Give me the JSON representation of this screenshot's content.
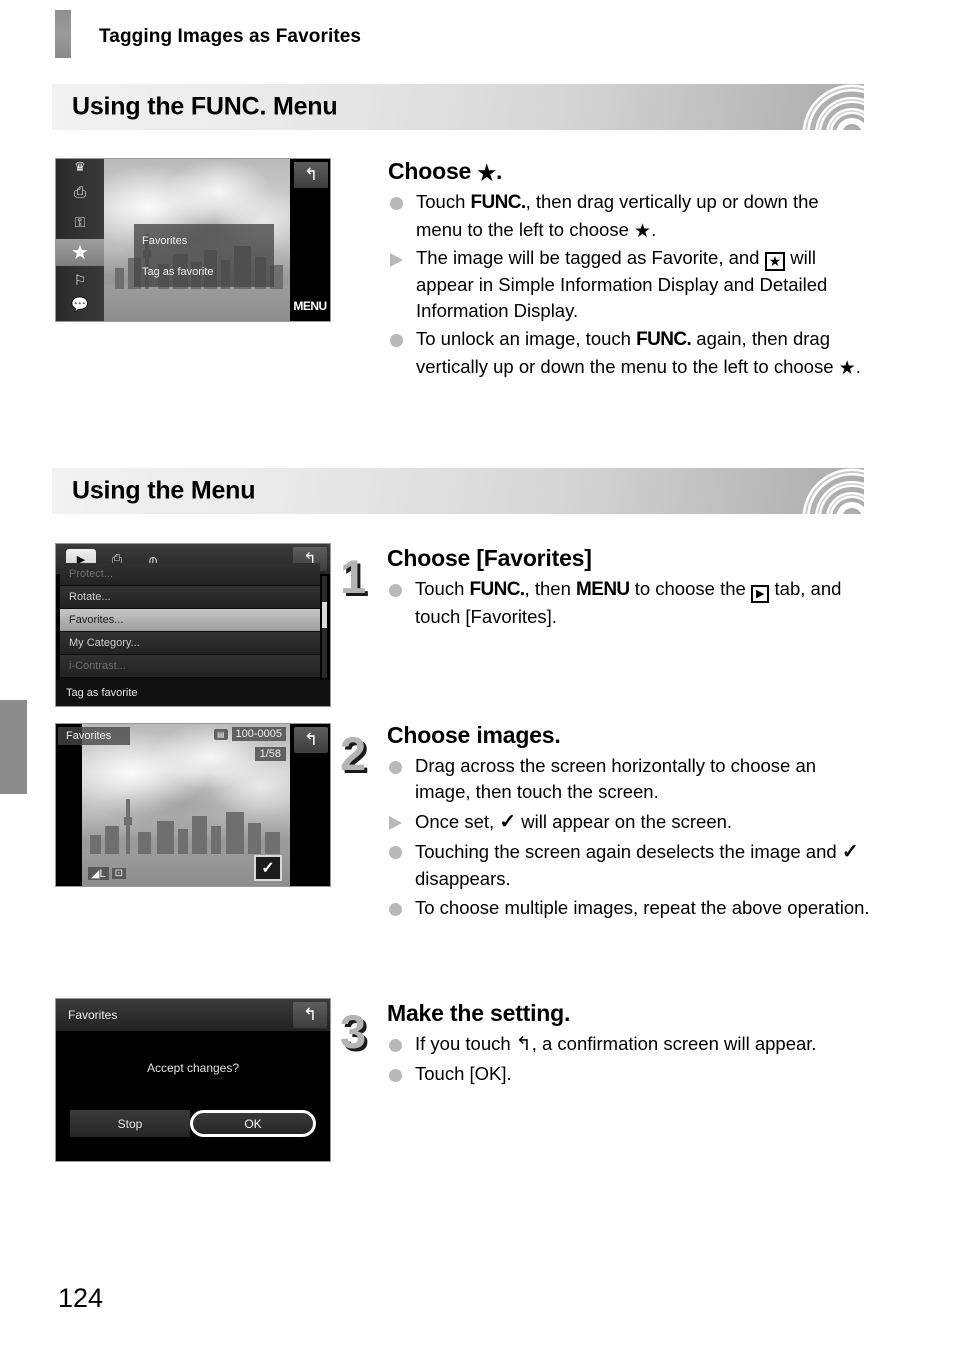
{
  "page": {
    "running_head": "Tagging Images as Favorites",
    "page_number": "124"
  },
  "sections": [
    {
      "title": "Using the FUNC. Menu"
    },
    {
      "title": "Using the Menu"
    }
  ],
  "func_section": {
    "heading": "Choose  ★.",
    "heading_prefix": "Choose",
    "heading_star": "★",
    "heading_suffix": ".",
    "bullets": [
      {
        "marker": "dot",
        "parts": [
          {
            "t": "Touch "
          },
          {
            "t": "FUNC.",
            "s": "func"
          },
          {
            "t": ", then drag vertically up or down the menu to the left to choose "
          },
          {
            "t": "★",
            "s": "star"
          },
          {
            "t": "."
          }
        ]
      },
      {
        "marker": "tri",
        "parts": [
          {
            "t": "The image will be tagged as Favorite, and "
          },
          {
            "t": "★",
            "s": "starbox"
          },
          {
            "t": " will appear in Simple Information Display and Detailed Information Display."
          }
        ]
      },
      {
        "marker": "dot",
        "parts": [
          {
            "t": "To unlock an image, touch "
          },
          {
            "t": "FUNC.",
            "s": "func"
          },
          {
            "t": " again, then drag vertically up or down the menu to the left to choose "
          },
          {
            "t": "★",
            "s": "star"
          },
          {
            "t": "."
          }
        ]
      }
    ]
  },
  "menu_section": {
    "steps": [
      {
        "number": "1",
        "heading": "Choose [Favorites]",
        "bullets": [
          {
            "marker": "dot",
            "parts": [
              {
                "t": "Touch "
              },
              {
                "t": "FUNC.",
                "s": "func"
              },
              {
                "t": ", then "
              },
              {
                "t": "MENU",
                "s": "menu"
              },
              {
                "t": " to choose the "
              },
              {
                "t": "▶",
                "s": "tabbox"
              },
              {
                "t": " tab, and touch [Favorites]."
              }
            ]
          }
        ]
      },
      {
        "number": "2",
        "heading": "Choose images.",
        "bullets": [
          {
            "marker": "dot",
            "parts": [
              {
                "t": "Drag across the screen horizontally to choose an image, then touch the screen."
              }
            ]
          },
          {
            "marker": "tri",
            "parts": [
              {
                "t": "Once set, "
              },
              {
                "t": "✓",
                "s": "check"
              },
              {
                "t": " will appear on the screen."
              }
            ]
          },
          {
            "marker": "dot",
            "parts": [
              {
                "t": "Touching the screen again deselects the image and "
              },
              {
                "t": "✓",
                "s": "check"
              },
              {
                "t": " disappears."
              }
            ]
          },
          {
            "marker": "dot",
            "parts": [
              {
                "t": "To choose multiple images, repeat the above operation."
              }
            ]
          }
        ]
      },
      {
        "number": "3",
        "heading": "Make the setting.",
        "bullets": [
          {
            "marker": "dot",
            "parts": [
              {
                "t": "If you touch "
              },
              {
                "t": "↰",
                "s": "back"
              },
              {
                "t": ", a confirmation screen will appear."
              }
            ]
          },
          {
            "marker": "dot",
            "parts": [
              {
                "t": "Touch [OK]."
              }
            ]
          }
        ]
      }
    ]
  },
  "screens": {
    "func_menu": {
      "caption_title": "Favorites",
      "caption_sub": "Tag as favorite",
      "menu_label": "MENU",
      "back_icon": "back-arrow-icon",
      "side_items": [
        {
          "icon": "crown-icon",
          "selected": false
        },
        {
          "icon": "print-icon",
          "selected": false
        },
        {
          "icon": "key-protect-icon",
          "selected": false
        },
        {
          "icon": "star-favorites-icon",
          "selected": true
        },
        {
          "icon": "category-icon",
          "selected": false
        },
        {
          "icon": "speech-bubble-play-icon",
          "selected": false
        },
        {
          "icon": "filmstrip-icon",
          "selected": false
        }
      ]
    },
    "menu_list": {
      "tabs": [
        {
          "icon": "playback-tab-icon",
          "label": "▶",
          "active": true
        },
        {
          "icon": "print-tab-icon",
          "label": "⎙",
          "active": false
        },
        {
          "icon": "settings-tab-icon",
          "label": "⫙",
          "active": false
        }
      ],
      "back_icon": "back-arrow-icon",
      "rows": [
        {
          "label": "Protect...",
          "state": "clipped-top"
        },
        {
          "label": "Rotate...",
          "state": "normal"
        },
        {
          "label": "Favorites...",
          "state": "selected"
        },
        {
          "label": "My Category...",
          "state": "normal"
        },
        {
          "label": "i-Contrast...",
          "state": "clipped-bottom"
        }
      ],
      "footer": "Tag as favorite"
    },
    "choose_images": {
      "mode_label": "Favorites",
      "file_number": "100-0005",
      "image_counter": "1/58",
      "back_icon": "back-arrow-icon",
      "quality_icon": "image-quality-icon",
      "check_icon": "check-mark-icon"
    },
    "confirm": {
      "title": "Favorites",
      "message": "Accept changes?",
      "buttons": [
        {
          "label": "Stop",
          "focused": false
        },
        {
          "label": "OK",
          "focused": true
        }
      ],
      "back_icon": "back-arrow-icon"
    }
  },
  "colors": {
    "header_light": "#f2f2f2",
    "header_dark": "#ababab",
    "bullet_gray": "#b9b9b9",
    "step_number_gray": "#b4b4b4",
    "tab_marker": "#8c8c8c"
  }
}
